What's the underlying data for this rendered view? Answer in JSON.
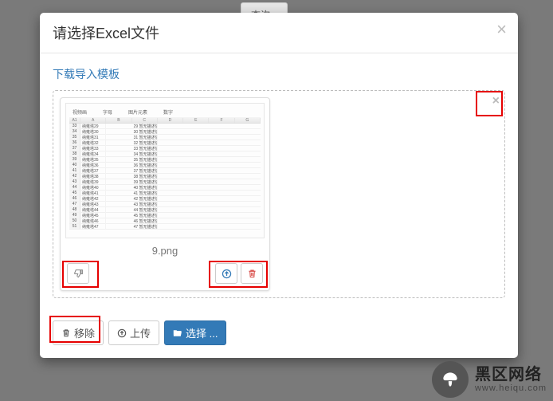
{
  "background": {
    "button_label": "查询"
  },
  "modal": {
    "title": "请选择Excel文件",
    "close_icon": "×",
    "download_template_label": "下载导入模板",
    "dropzone": {
      "close_icon": "×",
      "preview": {
        "filename": "9.png",
        "columns": [
          "A",
          "B",
          "C",
          "D",
          "E",
          "F",
          "G"
        ],
        "cell_ref": "A1",
        "top_tabs": [
          "视频画",
          "字母",
          "图片元素",
          "数字"
        ],
        "rows": [
          {
            "n": "33",
            "a": "纳雍塔29",
            "c": "29 暂无描述信息"
          },
          {
            "n": "34",
            "a": "纳雍塔30",
            "c": "30 暂无描述信息"
          },
          {
            "n": "35",
            "a": "纳雍塔31",
            "c": "31 暂无描述信息"
          },
          {
            "n": "36",
            "a": "纳雍塔32",
            "c": "32 暂无描述信息"
          },
          {
            "n": "37",
            "a": "纳雍塔33",
            "c": "33 暂无描述信息"
          },
          {
            "n": "38",
            "a": "纳雍塔34",
            "c": "34 暂无描述信息"
          },
          {
            "n": "39",
            "a": "纳雍塔35",
            "c": "35 暂无描述信息"
          },
          {
            "n": "40",
            "a": "纳雍塔36",
            "c": "36 暂无描述信息"
          },
          {
            "n": "41",
            "a": "纳雍塔37",
            "c": "37 暂无描述信息"
          },
          {
            "n": "42",
            "a": "纳雍塔38",
            "c": "38 暂无描述信息"
          },
          {
            "n": "43",
            "a": "纳雍塔39",
            "c": "39 暂无描述信息"
          },
          {
            "n": "44",
            "a": "纳雍塔40",
            "c": "40 暂无描述信息"
          },
          {
            "n": "45",
            "a": "纳雍塔41",
            "c": "41 暂无描述信息"
          },
          {
            "n": "46",
            "a": "纳雍塔42",
            "c": "42 暂无描述信息"
          },
          {
            "n": "47",
            "a": "纳雍塔43",
            "c": "43 暂无描述信息"
          },
          {
            "n": "48",
            "a": "纳雍塔44",
            "c": "44 暂无描述信息"
          },
          {
            "n": "49",
            "a": "纳雍塔45",
            "c": "45 暂无描述信息"
          },
          {
            "n": "50",
            "a": "纳雍塔46",
            "c": "46 暂无描述信息"
          },
          {
            "n": "51",
            "a": "纳雍塔47",
            "c": "47 暂无描述信息"
          }
        ]
      }
    },
    "footer": {
      "remove_label": "移除",
      "upload_label": "上传",
      "browse_label": "选择 ..."
    }
  },
  "watermark": {
    "cn": "黑区网络",
    "en": "www.heiqu.com"
  }
}
